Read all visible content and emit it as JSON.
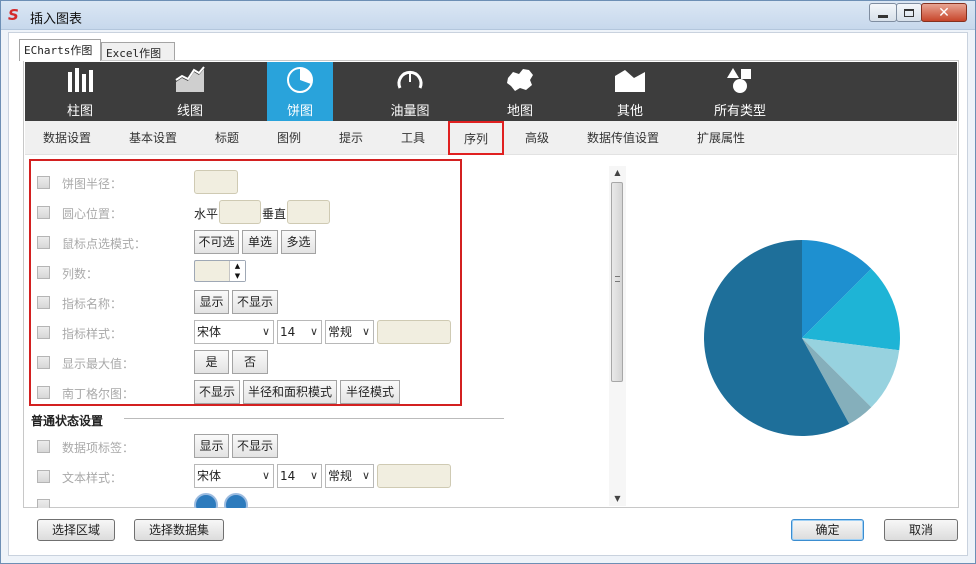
{
  "window": {
    "title": "插入图表"
  },
  "outer_tabs": [
    {
      "label": "ECharts作图"
    },
    {
      "label": "Excel作图"
    }
  ],
  "chart_types": [
    {
      "label": "柱图",
      "icon": "bar-chart-icon"
    },
    {
      "label": "线图",
      "icon": "line-chart-icon"
    },
    {
      "label": "饼图",
      "icon": "pie-chart-icon"
    },
    {
      "label": "油量图",
      "icon": "gauge-icon"
    },
    {
      "label": "地图",
      "icon": "china-map-icon"
    },
    {
      "label": "其他",
      "icon": "area-chart-icon"
    },
    {
      "label": "所有类型",
      "icon": "shapes-icon"
    }
  ],
  "sub_tabs": [
    {
      "label": "数据设置"
    },
    {
      "label": "基本设置"
    },
    {
      "label": "标题"
    },
    {
      "label": "图例"
    },
    {
      "label": "提示"
    },
    {
      "label": "工具"
    },
    {
      "label": "序列"
    },
    {
      "label": "高级"
    },
    {
      "label": "数据传值设置"
    },
    {
      "label": "扩展属性"
    }
  ],
  "settings": {
    "pie_radius": {
      "label": "饼图半径："
    },
    "center_position": {
      "label": "圆心位置：",
      "horizontal": "水平",
      "vertical": "垂直"
    },
    "mouse_select": {
      "label": "鼠标点选模式：",
      "options": [
        "不可选",
        "单选",
        "多选"
      ]
    },
    "columns": {
      "label": "列数："
    },
    "indicator_name": {
      "label": "指标名称：",
      "options": [
        "显示",
        "不显示"
      ]
    },
    "indicator_style": {
      "label": "指标样式：",
      "font": "宋体",
      "size": "14",
      "weight": "常规"
    },
    "show_max": {
      "label": "显示最大值：",
      "options": [
        "是",
        "否"
      ]
    },
    "nightingale": {
      "label": "南丁格尔图：",
      "options": [
        "不显示",
        "半径和面积模式",
        "半径模式"
      ]
    }
  },
  "normal_state": {
    "title": "普通状态设置",
    "data_label": {
      "label": "数据项标签：",
      "options": [
        "显示",
        "不显示"
      ]
    },
    "text_style": {
      "label": "文本样式：",
      "font": "宋体",
      "size": "14",
      "weight": "常规"
    }
  },
  "footer": {
    "select_area": "选择区域",
    "select_dataset": "选择数据集",
    "ok": "确定",
    "cancel": "取消"
  },
  "chart_data": {
    "type": "pie",
    "values": [
      12.5,
      14.5,
      10.5,
      4.5,
      58
    ],
    "colors": [
      "#1e90d0",
      "#1eb4d6",
      "#97d2df",
      "#85afbb",
      "#1e6f9a"
    ]
  }
}
